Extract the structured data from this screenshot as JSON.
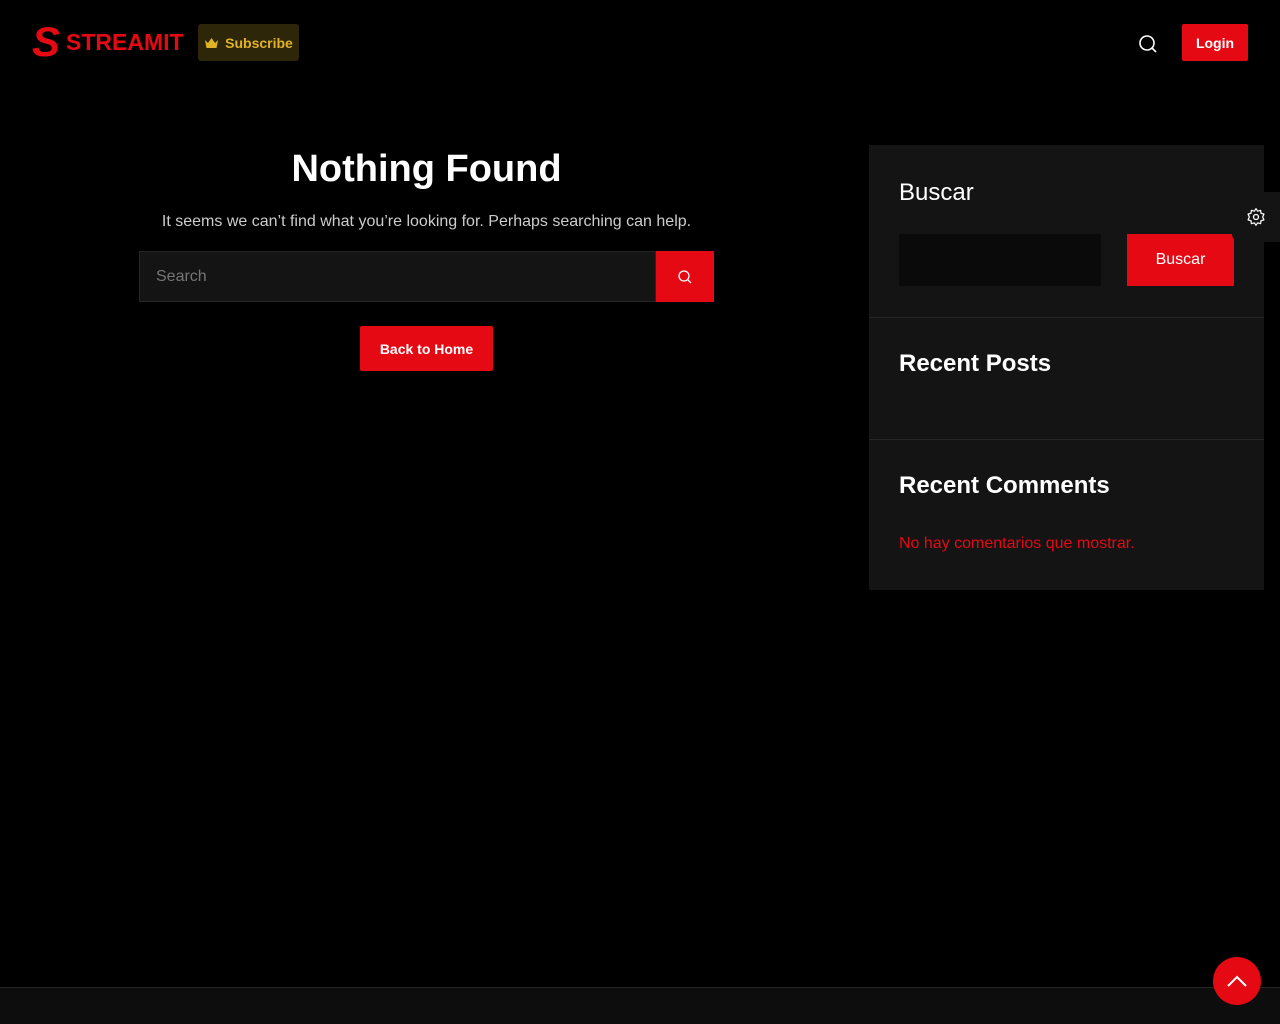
{
  "header": {
    "logo_letter": "S",
    "logo_text": "STREAMIT",
    "subscribe": "Subscribe",
    "login": "Login"
  },
  "main": {
    "title": "Nothing Found",
    "message": "It seems we can’t find what you’re looking for. Perhaps searching can help.",
    "search_placeholder": "Search",
    "back_home": "Back to Home"
  },
  "sidebar": {
    "search_title": "Buscar",
    "search_button": "Buscar",
    "recent_posts": "Recent Posts",
    "recent_comments": "Recent Comments",
    "no_comments": "No hay comentarios que mostrar."
  },
  "colors": {
    "accent": "#e50914",
    "gold": "#e0b324"
  }
}
